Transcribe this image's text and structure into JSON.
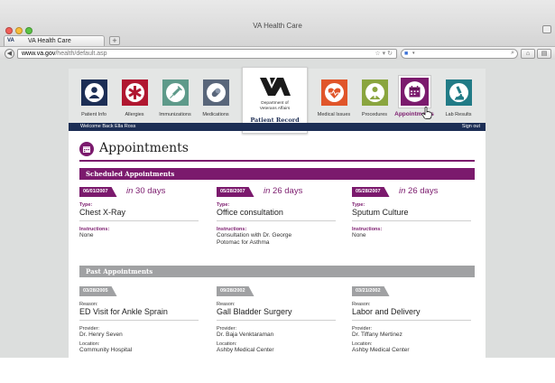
{
  "browser": {
    "window_title": "VA Health Care",
    "tab_label": "VA Health Care",
    "tab_favicon": "VA",
    "new_tab": "+",
    "url_domain": "www.va.gov",
    "url_path": "/health/default.asp",
    "search_engine": "g-icon"
  },
  "nav": {
    "items": [
      {
        "label": "Patient Info",
        "color": "#1c2e55",
        "icon": "person-icon"
      },
      {
        "label": "Allergies",
        "color": "#b01730",
        "icon": "medical-star-icon"
      },
      {
        "label": "Immunizations",
        "color": "#5e9a8a",
        "icon": "syringe-icon"
      },
      {
        "label": "Medications",
        "color": "#59667a",
        "icon": "pill-icon"
      },
      {
        "label": "Medical Issues",
        "color": "#e0552a",
        "icon": "heart-icon"
      },
      {
        "label": "Procedures",
        "color": "#8aa53f",
        "icon": "doctor-icon"
      },
      {
        "label": "Appointments",
        "color": "#7b1a6d",
        "icon": "calendar-icon"
      },
      {
        "label": "Lab Results",
        "color": "#217b86",
        "icon": "microscope-icon"
      }
    ],
    "active": "Appointments"
  },
  "logo": {
    "dept_line1": "Department of",
    "dept_line2": "Veterans Affairs",
    "record_label": "Patient Record"
  },
  "welcome": {
    "text": "Welcome Back Ella Ross",
    "signout": "Sign out"
  },
  "page": {
    "title": "Appointments",
    "accent": "#7b1a6d"
  },
  "scheduled": {
    "heading": "Scheduled Appointments",
    "items": [
      {
        "date": "06/01/2007",
        "in_word": "in",
        "in_value": "30 days",
        "type_label": "Type:",
        "type": "Chest X-Ray",
        "instr_label": "Instructions:",
        "instructions_1": "None",
        "instructions_2": ""
      },
      {
        "date": "05/28/2007",
        "in_word": "in",
        "in_value": "26 days",
        "type_label": "Type:",
        "type": "Office consultation",
        "instr_label": "Instructions:",
        "instructions_1": "Consultation with Dr. George",
        "instructions_2": "Potomac for Asthma"
      },
      {
        "date": "05/28/2007",
        "in_word": "in",
        "in_value": "26 days",
        "type_label": "Type:",
        "type": "Sputum Culture",
        "instr_label": "Instructions:",
        "instructions_1": "None",
        "instructions_2": ""
      }
    ]
  },
  "past": {
    "heading": "Past Appointments",
    "items": [
      {
        "date": "03/28/2005",
        "reason_label": "Reason:",
        "reason": "ED Visit for Ankle Sprain",
        "provider_label": "Provider:",
        "provider": "Dr. Henry Seven",
        "location_label": "Location:",
        "location": "Community Hospital"
      },
      {
        "date": "09/28/2002",
        "reason_label": "Reason:",
        "reason": "Gall Bladder Surgery",
        "provider_label": "Provider:",
        "provider": "Dr. Baja Venktaraman",
        "location_label": "Location:",
        "location": "Ashby Medical Center"
      },
      {
        "date": "03/21/2002",
        "reason_label": "Reason:",
        "reason": "Labor and Delivery",
        "provider_label": "Provider:",
        "provider": "Dr. Tiffany Mertinez",
        "location_label": "Location:",
        "location": "Ashby Medical Center"
      }
    ]
  }
}
